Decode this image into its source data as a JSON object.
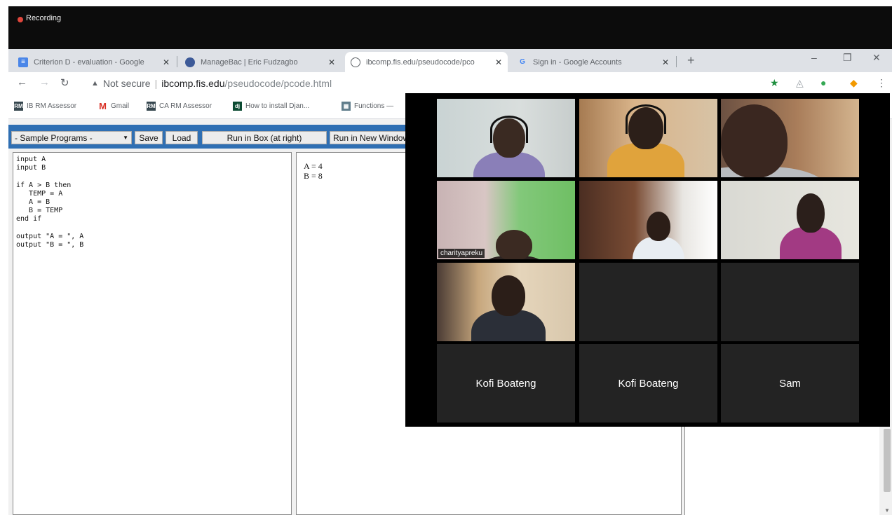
{
  "recording": {
    "label": "Recording"
  },
  "tabs": [
    {
      "title": "Criterion D - evaluation - Google",
      "icon": "google-docs-icon"
    },
    {
      "title": "ManageBac | Eric Fudzagbo",
      "icon": "managebac-icon"
    },
    {
      "title": "ibcomp.fis.edu/pseudocode/pco",
      "icon": "globe-icon"
    },
    {
      "title": "Sign in - Google Accounts",
      "icon": "google-icon"
    }
  ],
  "address": {
    "security_label": "Not secure",
    "host": "ibcomp.fis.edu",
    "path": "/pseudocode/pcode.html"
  },
  "bookmarks": [
    {
      "label": "IB RM Assessor",
      "icon": "rm-icon"
    },
    {
      "label": "Gmail",
      "icon": "gmail-icon"
    },
    {
      "label": "CA RM Assessor",
      "icon": "rm-icon"
    },
    {
      "label": "How to install Djan...",
      "icon": "django-icon"
    },
    {
      "label": "Functions —",
      "icon": "functions-icon"
    }
  ],
  "controls": {
    "samples_select": "- Sample Programs -",
    "save_label": "Save",
    "load_label": "Load",
    "run_box_label": "Run in Box (at right)",
    "run_window_label": "Run in New Window"
  },
  "code_lines": [
    "input A",
    "input B",
    "",
    "if A > B then",
    "   TEMP = A",
    "   A = B",
    "   B = TEMP",
    "end if",
    "",
    "output \"A = \", A",
    "output \"B = \", B"
  ],
  "output_lines": [
    "A = 4",
    "B = 8"
  ],
  "video": {
    "tiles": [
      {
        "kind": "camera"
      },
      {
        "kind": "camera"
      },
      {
        "kind": "camera"
      },
      {
        "kind": "camera",
        "name": "charityapreku"
      },
      {
        "kind": "camera"
      },
      {
        "kind": "camera"
      },
      {
        "kind": "camera"
      },
      {
        "kind": "empty"
      },
      {
        "kind": "empty"
      },
      {
        "kind": "name",
        "name": "Kofi Boateng"
      },
      {
        "kind": "name",
        "name": "Kofi Boateng"
      },
      {
        "kind": "name",
        "name": "Sam"
      }
    ]
  },
  "colors": {
    "control_bar": "#2f6fb3",
    "recording_dot": "#e0463c",
    "highlight_tile": "#c8d88a"
  }
}
